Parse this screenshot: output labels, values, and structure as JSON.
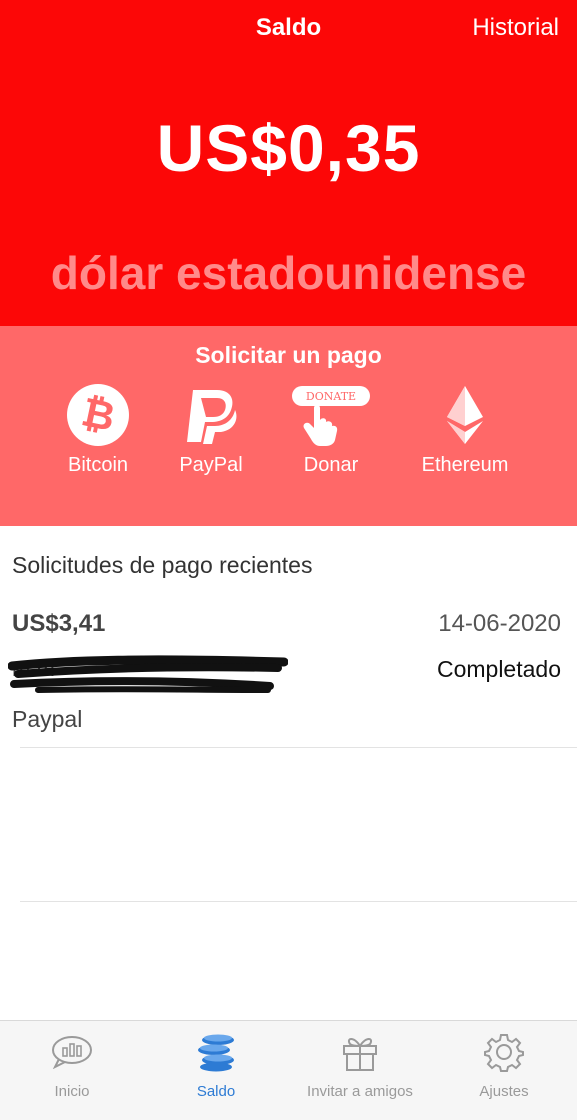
{
  "header": {
    "title": "Saldo",
    "history_link": "Historial",
    "balance": "US$0,35",
    "currency_name": "dólar estadounidense",
    "bg_color": "#fc0707"
  },
  "request": {
    "title": "Solicitar un pago",
    "methods": [
      {
        "label": "Bitcoin",
        "icon": "bitcoin-icon"
      },
      {
        "label": "PayPal",
        "icon": "paypal-icon"
      },
      {
        "label": "Donar",
        "icon": "donate-icon",
        "badge": "DONATE"
      },
      {
        "label": "Ethereum",
        "icon": "ethereum-icon"
      }
    ],
    "bg_color": "#ff6868"
  },
  "recent": {
    "title": "Solicitudes de pago recientes",
    "items": [
      {
        "amount": "US$3,41",
        "date": "14-06-2020",
        "email_visible": "m                               m",
        "status": "Completado",
        "method": "Paypal"
      }
    ]
  },
  "tabs": [
    {
      "label": "Inicio",
      "icon": "chart-bubble-icon",
      "active": false
    },
    {
      "label": "Saldo",
      "icon": "coins-icon",
      "active": true
    },
    {
      "label": "Invitar a amigos",
      "icon": "gift-icon",
      "active": false
    },
    {
      "label": "Ajustes",
      "icon": "gear-icon",
      "active": false
    }
  ],
  "colors": {
    "active_tab": "#2d7bd4",
    "inactive_tab": "#9a9a9a"
  }
}
